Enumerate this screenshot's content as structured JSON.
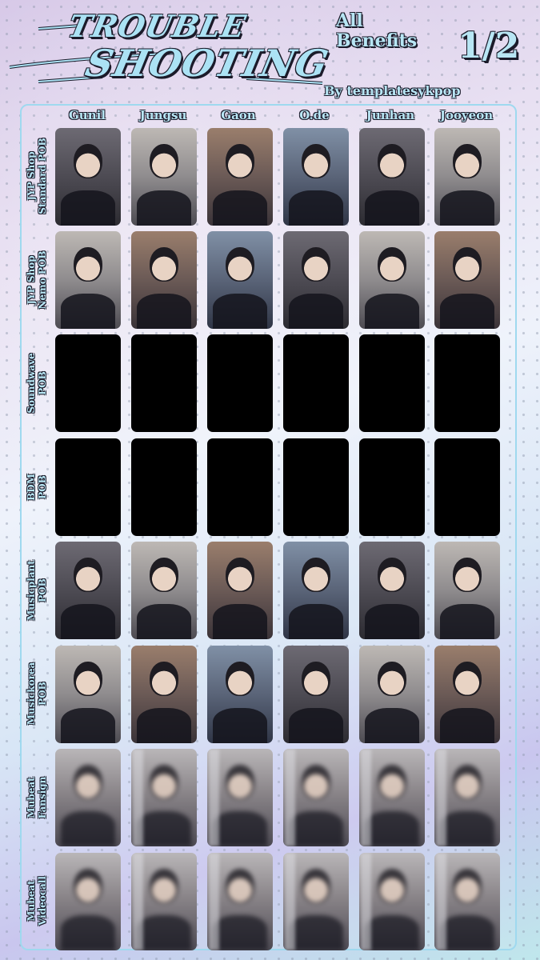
{
  "header": {
    "title_line1": "TROUBLE",
    "title_line2": "SHOOTING",
    "subtitle": "All Benefits",
    "page": "1/2",
    "credit": "By templatesykpop"
  },
  "members": [
    "Gunil",
    "Jungsu",
    "Gaon",
    "O.de",
    "Junhan",
    "Jooyeon"
  ],
  "rows": [
    {
      "label_line1": "JYP Shop",
      "label_line2": "Standard POB",
      "cards": "photo"
    },
    {
      "label_line1": "JYP Shop",
      "label_line2": "Nemo POB",
      "cards": "photo"
    },
    {
      "label_line1": "Soundwave",
      "label_line2": "POB",
      "cards": "black"
    },
    {
      "label_line1": "BDM",
      "label_line2": "POB",
      "cards": "black"
    },
    {
      "label_line1": "Musicplant",
      "label_line2": "POB",
      "cards": "photo"
    },
    {
      "label_line1": "Musickorea",
      "label_line2": "POB",
      "cards": "photo"
    },
    {
      "label_line1": "Mubeat",
      "label_line2": "Fansign",
      "cards": "blurry"
    },
    {
      "label_line1": "Mubeat",
      "label_line2": "Videocall",
      "cards": "blurry"
    }
  ],
  "colors": {
    "accent": "#b8e6f4",
    "outline": "#1b1b2a",
    "board_border": "#9fd9ef",
    "placeholder_card": "#000000"
  }
}
